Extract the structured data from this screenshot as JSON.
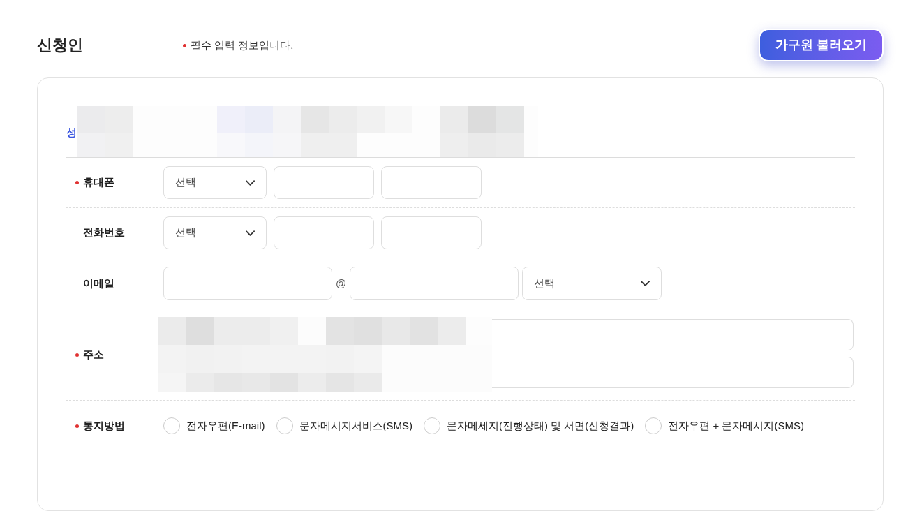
{
  "header": {
    "title": "신청인",
    "required_note": "필수 입력 정보입니다.",
    "load_button": "가구원 불러오기"
  },
  "rows": [
    {
      "kind": "name",
      "label": "성",
      "required": false
    },
    {
      "kind": "phone",
      "label": "휴대폰",
      "required": true,
      "parts": [
        {
          "kind": "select",
          "value": "선택"
        },
        {
          "kind": "input"
        },
        {
          "kind": "input"
        }
      ]
    },
    {
      "kind": "phone",
      "label": "전화번호",
      "required": false,
      "parts": [
        {
          "kind": "select",
          "value": "선택"
        },
        {
          "kind": "input"
        },
        {
          "kind": "input"
        }
      ]
    },
    {
      "kind": "email",
      "label": "이메일",
      "required": false,
      "parts": [
        {
          "kind": "input"
        },
        {
          "kind": "separator",
          "text": "@"
        },
        {
          "kind": "input"
        },
        {
          "kind": "select",
          "value": "선택"
        }
      ]
    },
    {
      "kind": "address",
      "label": "주소",
      "required": true,
      "parts": [
        {
          "kind": "input"
        },
        {
          "kind": "input"
        }
      ]
    },
    {
      "kind": "notify",
      "label": "통지방법",
      "required": true,
      "options": [
        {
          "label": "전자우편(E-mail)",
          "selected": false
        },
        {
          "label": "문자메시지서비스(SMS)",
          "selected": false
        },
        {
          "label": "문자메세지(진행상태) 및 서면(신청결과)",
          "selected": false
        },
        {
          "label": "전자우편 + 문자메시지(SMS)",
          "selected": false
        }
      ]
    }
  ]
}
